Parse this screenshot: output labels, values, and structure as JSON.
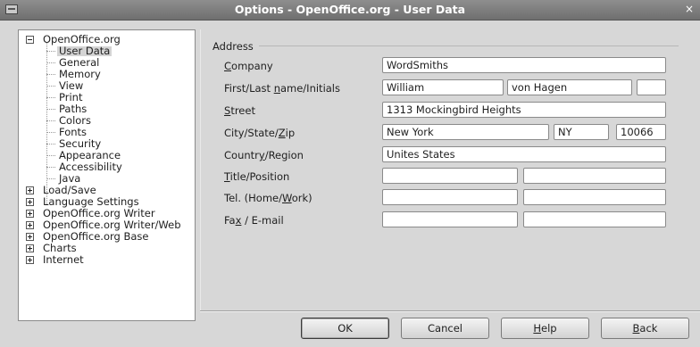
{
  "window": {
    "title": "Options - OpenOffice.org - User Data",
    "close_glyph": "×",
    "icon": "window-menu-icon"
  },
  "tree": {
    "root": {
      "label": "OpenOffice.org",
      "expanded": true
    },
    "children": [
      "User Data",
      "General",
      "Memory",
      "View",
      "Print",
      "Paths",
      "Colors",
      "Fonts",
      "Security",
      "Appearance",
      "Accessibility",
      "Java"
    ],
    "selected": "User Data",
    "collapsed": [
      "Load/Save",
      "Language Settings",
      "OpenOffice.org Writer",
      "OpenOffice.org Writer/Web",
      "OpenOffice.org Base",
      "Charts",
      "Internet"
    ]
  },
  "address": {
    "group_label": "Address",
    "labels": {
      "company_pre": "",
      "company_key": "C",
      "company_post": "ompany",
      "name_pre": "First/Last ",
      "name_key": "n",
      "name_post": "ame/Initials",
      "street_pre": "",
      "street_key": "S",
      "street_post": "treet",
      "city_pre": "City/State/",
      "city_key": "Z",
      "city_post": "ip",
      "country_pre": "Countr",
      "country_key": "y",
      "country_post": "/Region",
      "title_pre": "",
      "title_key": "T",
      "title_post": "itle/Position",
      "tel_pre": "Tel. (Home/",
      "tel_key": "W",
      "tel_post": "ork)",
      "fax_pre": "Fa",
      "fax_key": "x",
      "fax_post": " / E-mail"
    },
    "values": {
      "company": "WordSmiths",
      "first_name": "William",
      "last_name": "von Hagen",
      "initials": "",
      "street": "1313 Mockingbird Heights",
      "city": "New York",
      "state": "NY",
      "zip": "10066",
      "country": "Unites States",
      "title": "",
      "position": "",
      "tel_home": "",
      "tel_work": "",
      "fax": "",
      "email": ""
    }
  },
  "buttons": {
    "ok": "OK",
    "cancel": "Cancel",
    "help_key": "H",
    "help_post": "elp",
    "back_key": "B",
    "back_post": "ack"
  }
}
